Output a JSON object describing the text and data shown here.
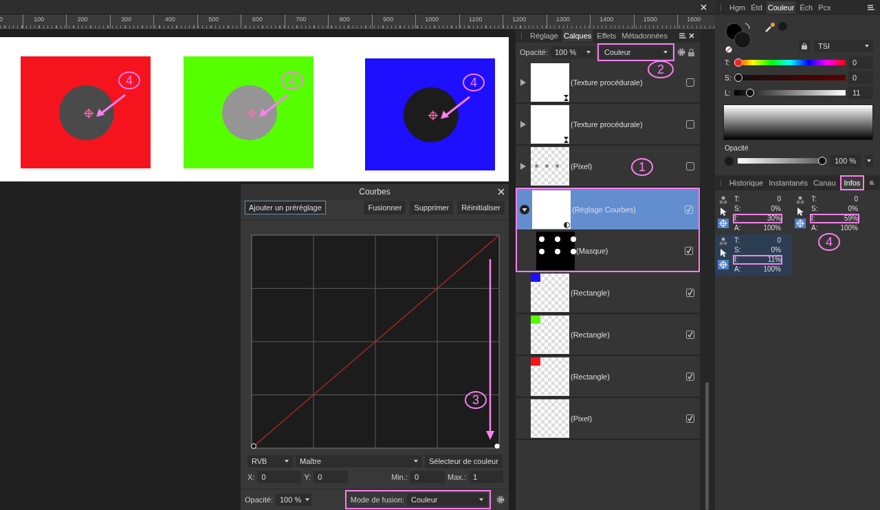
{
  "ruler": {
    "ticks": [
      "0",
      "100",
      "200",
      "300",
      "400",
      "500",
      "600",
      "700",
      "800",
      "900",
      "1000",
      "1100",
      "1200",
      "1300",
      "1400",
      "1500",
      "1600"
    ]
  },
  "document": {
    "shapes": [
      {
        "color": "#f5141e",
        "circle": {
          "color": "#4a4a4a"
        },
        "callout": "4"
      },
      {
        "color": "#55ff00",
        "circle": {
          "color": "#959595"
        },
        "callout": "4"
      },
      {
        "color": "#1e0fff",
        "circle": {
          "color": "#1c1c1c"
        },
        "callout": "4"
      }
    ]
  },
  "curves": {
    "title": "Courbes",
    "preset_button": "Ajouter un préréglage",
    "buttons": [
      "Fusionner",
      "Supprimer",
      "Réinitialiser"
    ],
    "callout": "3",
    "channel": "RVB",
    "mode": "Maître",
    "picker_button": "Sélecteur de couleur",
    "fields": [
      {
        "label": "X:",
        "value": "0"
      },
      {
        "label": "Y:",
        "value": "0"
      },
      {
        "label": "Min.:",
        "value": "0"
      },
      {
        "label": "Max.:",
        "value": "1"
      }
    ],
    "opacity_label": "Opacité:",
    "opacity": "100 %",
    "blend_label": "Mode de fusion:",
    "blend": "Couleur",
    "blend_highlighted": true
  },
  "layers_panel": {
    "tabs": [
      {
        "label": "Réglage",
        "selected": false
      },
      {
        "label": "Calques",
        "selected": true
      },
      {
        "label": "Effets",
        "selected": false
      },
      {
        "label": "Métadonnées",
        "selected": false
      }
    ],
    "opacity_label": "Opacité:",
    "opacity": "100 %",
    "blend": "Couleur",
    "blend_highlighted": true,
    "blend_callout": "2",
    "layers": [
      {
        "name": "(Texture procédurale)",
        "kind": "texture",
        "checked": false,
        "selected": false,
        "expanded": false,
        "highlighted": false
      },
      {
        "name": "(Texture procédurale)",
        "kind": "texture",
        "checked": false,
        "selected": false,
        "expanded": false,
        "highlighted": false
      },
      {
        "name": "(Pixel)",
        "kind": "dots",
        "checked": false,
        "selected": false,
        "expanded": false,
        "highlighted": false,
        "callout": "1"
      },
      {
        "name": "(Réglage Courbes)",
        "kind": "adjustment",
        "checked": true,
        "selected": true,
        "expanded": true,
        "highlighted": true,
        "children": [
          {
            "name": "(Masque)",
            "kind": "mask",
            "checked": true,
            "selected": false
          }
        ]
      },
      {
        "name": "(Rectangle)",
        "kind": "rect",
        "color": "#1e0fff",
        "checked": true,
        "selected": false,
        "highlighted": false
      },
      {
        "name": "(Rectangle)",
        "kind": "rect",
        "color": "#55ff00",
        "checked": true,
        "selected": false,
        "highlighted": false
      },
      {
        "name": "(Rectangle)",
        "kind": "rect",
        "color": "#f5141e",
        "checked": true,
        "selected": false,
        "highlighted": false
      },
      {
        "name": "(Pixel)",
        "kind": "band",
        "checked": true,
        "selected": false,
        "highlighted": false
      }
    ]
  },
  "color_panel": {
    "tabs": [
      {
        "label": "Hgm",
        "selected": false
      },
      {
        "label": "Étd",
        "selected": false
      },
      {
        "label": "Couleur",
        "selected": true
      },
      {
        "label": "Éch",
        "selected": false
      },
      {
        "label": "Pcx",
        "selected": false
      }
    ],
    "model": "TSI",
    "sliders": [
      {
        "kind": "hue",
        "label": "T:",
        "level": 0,
        "value": "0"
      },
      {
        "kind": "saturation",
        "label": "S:",
        "level": 0,
        "value": "0"
      },
      {
        "kind": "lightness",
        "label": "L:",
        "level": 0.11,
        "value": "11"
      }
    ],
    "opacity_label": "Opacité",
    "opacity_slider": {
      "level": 1
    },
    "opacity": "100 %"
  },
  "info_panel": {
    "tabs": [
      {
        "label": "Historique",
        "selected": false,
        "highlighted": false
      },
      {
        "label": "Instantanés",
        "selected": false,
        "highlighted": false
      },
      {
        "label": "Canau",
        "selected": false,
        "highlighted": false
      },
      {
        "label": "Infos",
        "selected": true,
        "highlighted": true
      }
    ],
    "callout": "4",
    "readouts": [
      {
        "selected": false,
        "rows": [
          {
            "label": "T:",
            "value": "0",
            "highlighted": false
          },
          {
            "label": "S:",
            "value": "0%",
            "highlighted": false
          },
          {
            "label": "I:",
            "value": "30%",
            "highlighted": true
          },
          {
            "label": "A:",
            "value": "100%",
            "highlighted": false
          }
        ]
      },
      {
        "selected": false,
        "rows": [
          {
            "label": "T:",
            "value": "0",
            "highlighted": false
          },
          {
            "label": "S:",
            "value": "0%",
            "highlighted": false
          },
          {
            "label": "I:",
            "value": "59%",
            "highlighted": true
          },
          {
            "label": "A:",
            "value": "100%",
            "highlighted": false
          }
        ]
      },
      {
        "selected": true,
        "rows": [
          {
            "label": "T:",
            "value": "0",
            "highlighted": false
          },
          {
            "label": "S:",
            "value": "0%",
            "highlighted": false
          },
          {
            "label": "I:",
            "value": "11%",
            "highlighted": true
          },
          {
            "label": "A:",
            "value": "100%",
            "highlighted": false
          }
        ]
      }
    ]
  }
}
